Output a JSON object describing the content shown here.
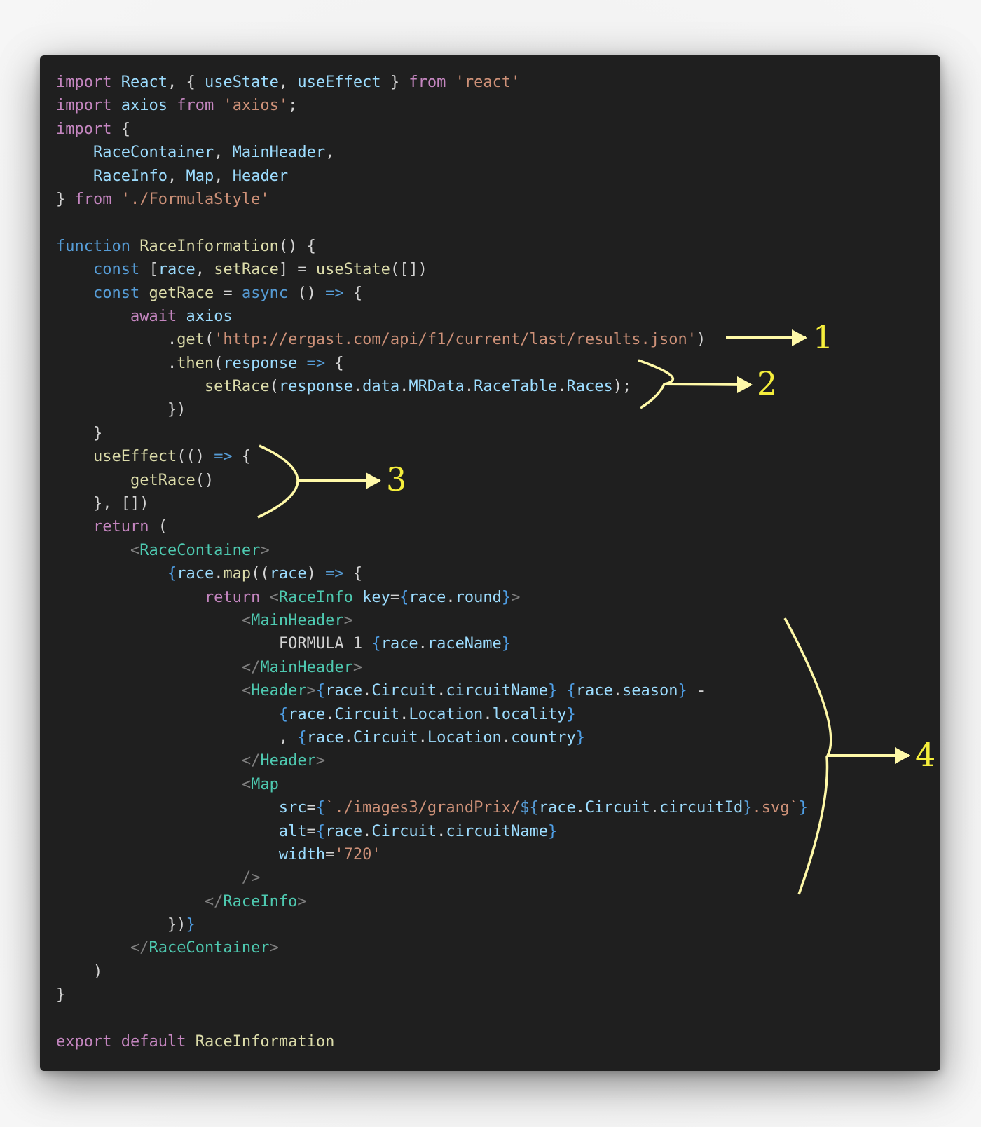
{
  "code_lines": [
    [
      [
        "kw",
        "import"
      ],
      [
        "plain",
        " "
      ],
      [
        "var",
        "React"
      ],
      [
        "plain",
        ", { "
      ],
      [
        "var",
        "useState"
      ],
      [
        "plain",
        ", "
      ],
      [
        "var",
        "useEffect"
      ],
      [
        "plain",
        " } "
      ],
      [
        "kw",
        "from"
      ],
      [
        "plain",
        " "
      ],
      [
        "str",
        "'react'"
      ]
    ],
    [
      [
        "kw",
        "import"
      ],
      [
        "plain",
        " "
      ],
      [
        "var",
        "axios"
      ],
      [
        "plain",
        " "
      ],
      [
        "kw",
        "from"
      ],
      [
        "plain",
        " "
      ],
      [
        "str",
        "'axios'"
      ],
      [
        "plain",
        ";"
      ]
    ],
    [
      [
        "kw",
        "import"
      ],
      [
        "plain",
        " {"
      ]
    ],
    [
      [
        "plain",
        "    "
      ],
      [
        "var",
        "RaceContainer"
      ],
      [
        "plain",
        ", "
      ],
      [
        "var",
        "MainHeader"
      ],
      [
        "plain",
        ","
      ]
    ],
    [
      [
        "plain",
        "    "
      ],
      [
        "var",
        "RaceInfo"
      ],
      [
        "plain",
        ", "
      ],
      [
        "var",
        "Map"
      ],
      [
        "plain",
        ", "
      ],
      [
        "var",
        "Header"
      ]
    ],
    [
      [
        "plain",
        "} "
      ],
      [
        "kw",
        "from"
      ],
      [
        "plain",
        " "
      ],
      [
        "str",
        "'./FormulaStyle'"
      ]
    ],
    [],
    [
      [
        "dec",
        "function"
      ],
      [
        "plain",
        " "
      ],
      [
        "fn",
        "RaceInformation"
      ],
      [
        "plain",
        "() {"
      ]
    ],
    [
      [
        "plain",
        "    "
      ],
      [
        "dec",
        "const"
      ],
      [
        "plain",
        " ["
      ],
      [
        "var",
        "race"
      ],
      [
        "plain",
        ", "
      ],
      [
        "fn",
        "setRace"
      ],
      [
        "plain",
        "] = "
      ],
      [
        "fn",
        "useState"
      ],
      [
        "plain",
        "([])"
      ]
    ],
    [
      [
        "plain",
        "    "
      ],
      [
        "dec",
        "const"
      ],
      [
        "plain",
        " "
      ],
      [
        "fn",
        "getRace"
      ],
      [
        "plain",
        " = "
      ],
      [
        "dec",
        "async"
      ],
      [
        "plain",
        " () "
      ],
      [
        "dec",
        "=>"
      ],
      [
        "plain",
        " {"
      ]
    ],
    [
      [
        "plain",
        "        "
      ],
      [
        "kw",
        "await"
      ],
      [
        "plain",
        " "
      ],
      [
        "var",
        "axios"
      ]
    ],
    [
      [
        "plain",
        "            ."
      ],
      [
        "fn",
        "get"
      ],
      [
        "plain",
        "("
      ],
      [
        "str",
        "'http://ergast.com/api/f1/current/last/results.json'"
      ],
      [
        "plain",
        ")"
      ]
    ],
    [
      [
        "plain",
        "            ."
      ],
      [
        "fn",
        "then"
      ],
      [
        "plain",
        "("
      ],
      [
        "var",
        "response"
      ],
      [
        "plain",
        " "
      ],
      [
        "dec",
        "=>"
      ],
      [
        "plain",
        " {"
      ]
    ],
    [
      [
        "plain",
        "                "
      ],
      [
        "fn",
        "setRace"
      ],
      [
        "plain",
        "("
      ],
      [
        "var",
        "response"
      ],
      [
        "plain",
        "."
      ],
      [
        "var",
        "data"
      ],
      [
        "plain",
        "."
      ],
      [
        "var",
        "MRData"
      ],
      [
        "plain",
        "."
      ],
      [
        "var",
        "RaceTable"
      ],
      [
        "plain",
        "."
      ],
      [
        "var",
        "Races"
      ],
      [
        "plain",
        ");"
      ]
    ],
    [
      [
        "plain",
        "            })"
      ]
    ],
    [
      [
        "plain",
        "    }"
      ]
    ],
    [
      [
        "plain",
        "    "
      ],
      [
        "fn",
        "useEffect"
      ],
      [
        "plain",
        "(() "
      ],
      [
        "dec",
        "=>"
      ],
      [
        "plain",
        " {"
      ]
    ],
    [
      [
        "plain",
        "        "
      ],
      [
        "fn",
        "getRace"
      ],
      [
        "plain",
        "()"
      ]
    ],
    [
      [
        "plain",
        "    }, [])"
      ]
    ],
    [
      [
        "plain",
        "    "
      ],
      [
        "kw",
        "return"
      ],
      [
        "plain",
        " ("
      ]
    ],
    [
      [
        "plain",
        "        "
      ],
      [
        "ang",
        "<"
      ],
      [
        "tag",
        "RaceContainer"
      ],
      [
        "ang",
        ">"
      ]
    ],
    [
      [
        "plain",
        "            "
      ],
      [
        "br",
        "{"
      ],
      [
        "var",
        "race"
      ],
      [
        "plain",
        "."
      ],
      [
        "fn",
        "map"
      ],
      [
        "plain",
        "(("
      ],
      [
        "var",
        "race"
      ],
      [
        "plain",
        ") "
      ],
      [
        "dec",
        "=>"
      ],
      [
        "plain",
        " {"
      ]
    ],
    [
      [
        "plain",
        "                "
      ],
      [
        "kw",
        "return"
      ],
      [
        "plain",
        " "
      ],
      [
        "ang",
        "<"
      ],
      [
        "tag",
        "RaceInfo"
      ],
      [
        "plain",
        " "
      ],
      [
        "var",
        "key"
      ],
      [
        "plain",
        "="
      ],
      [
        "br",
        "{"
      ],
      [
        "var",
        "race"
      ],
      [
        "plain",
        "."
      ],
      [
        "var",
        "round"
      ],
      [
        "br",
        "}"
      ],
      [
        "ang",
        ">"
      ]
    ],
    [
      [
        "plain",
        "                    "
      ],
      [
        "ang",
        "<"
      ],
      [
        "tag",
        "MainHeader"
      ],
      [
        "ang",
        ">"
      ]
    ],
    [
      [
        "plain",
        "                        "
      ],
      [
        "txt",
        "FORMULA 1 "
      ],
      [
        "br",
        "{"
      ],
      [
        "var",
        "race"
      ],
      [
        "plain",
        "."
      ],
      [
        "var",
        "raceName"
      ],
      [
        "br",
        "}"
      ]
    ],
    [
      [
        "plain",
        "                    "
      ],
      [
        "ang",
        "</"
      ],
      [
        "tag",
        "MainHeader"
      ],
      [
        "ang",
        ">"
      ]
    ],
    [
      [
        "plain",
        "                    "
      ],
      [
        "ang",
        "<"
      ],
      [
        "tag",
        "Header"
      ],
      [
        "ang",
        ">"
      ],
      [
        "br",
        "{"
      ],
      [
        "var",
        "race"
      ],
      [
        "plain",
        "."
      ],
      [
        "var",
        "Circuit"
      ],
      [
        "plain",
        "."
      ],
      [
        "var",
        "circuitName"
      ],
      [
        "br",
        "}"
      ],
      [
        "plain",
        " "
      ],
      [
        "br",
        "{"
      ],
      [
        "var",
        "race"
      ],
      [
        "plain",
        "."
      ],
      [
        "var",
        "season"
      ],
      [
        "br",
        "}"
      ],
      [
        "txt",
        " -"
      ]
    ],
    [
      [
        "plain",
        "                        "
      ],
      [
        "br",
        "{"
      ],
      [
        "var",
        "race"
      ],
      [
        "plain",
        "."
      ],
      [
        "var",
        "Circuit"
      ],
      [
        "plain",
        "."
      ],
      [
        "var",
        "Location"
      ],
      [
        "plain",
        "."
      ],
      [
        "var",
        "locality"
      ],
      [
        "br",
        "}"
      ]
    ],
    [
      [
        "plain",
        "                        "
      ],
      [
        "txt",
        ", "
      ],
      [
        "br",
        "{"
      ],
      [
        "var",
        "race"
      ],
      [
        "plain",
        "."
      ],
      [
        "var",
        "Circuit"
      ],
      [
        "plain",
        "."
      ],
      [
        "var",
        "Location"
      ],
      [
        "plain",
        "."
      ],
      [
        "var",
        "country"
      ],
      [
        "br",
        "}"
      ]
    ],
    [
      [
        "plain",
        "                    "
      ],
      [
        "ang",
        "</"
      ],
      [
        "tag",
        "Header"
      ],
      [
        "ang",
        ">"
      ]
    ],
    [
      [
        "plain",
        "                    "
      ],
      [
        "ang",
        "<"
      ],
      [
        "tag",
        "Map"
      ]
    ],
    [
      [
        "plain",
        "                        "
      ],
      [
        "var",
        "src"
      ],
      [
        "plain",
        "="
      ],
      [
        "br",
        "{"
      ],
      [
        "str",
        "`./images3/grandPrix/"
      ],
      [
        "dec",
        "${"
      ],
      [
        "var",
        "race"
      ],
      [
        "plain",
        "."
      ],
      [
        "var",
        "Circuit"
      ],
      [
        "plain",
        "."
      ],
      [
        "var",
        "circuitId"
      ],
      [
        "dec",
        "}"
      ],
      [
        "str",
        ".svg`"
      ],
      [
        "br",
        "}"
      ]
    ],
    [
      [
        "plain",
        "                        "
      ],
      [
        "var",
        "alt"
      ],
      [
        "plain",
        "="
      ],
      [
        "br",
        "{"
      ],
      [
        "var",
        "race"
      ],
      [
        "plain",
        "."
      ],
      [
        "var",
        "Circuit"
      ],
      [
        "plain",
        "."
      ],
      [
        "var",
        "circuitName"
      ],
      [
        "br",
        "}"
      ]
    ],
    [
      [
        "plain",
        "                        "
      ],
      [
        "var",
        "width"
      ],
      [
        "plain",
        "="
      ],
      [
        "str",
        "'720'"
      ]
    ],
    [
      [
        "plain",
        "                    "
      ],
      [
        "ang",
        "/>"
      ]
    ],
    [
      [
        "plain",
        "                "
      ],
      [
        "ang",
        "</"
      ],
      [
        "tag",
        "RaceInfo"
      ],
      [
        "ang",
        ">"
      ]
    ],
    [
      [
        "plain",
        "            })"
      ],
      [
        "br",
        "}"
      ]
    ],
    [
      [
        "plain",
        "        "
      ],
      [
        "ang",
        "</"
      ],
      [
        "tag",
        "RaceContainer"
      ],
      [
        "ang",
        ">"
      ]
    ],
    [
      [
        "plain",
        "    )"
      ]
    ],
    [
      [
        "plain",
        "}"
      ]
    ],
    [],
    [
      [
        "kw",
        "export"
      ],
      [
        "plain",
        " "
      ],
      [
        "kw",
        "default"
      ],
      [
        "plain",
        " "
      ],
      [
        "fn",
        "RaceInformation"
      ]
    ]
  ],
  "annotations": [
    {
      "label": "1"
    },
    {
      "label": "2"
    },
    {
      "label": "3"
    },
    {
      "label": "4"
    }
  ],
  "colors": {
    "panel_bg": "#1f1f1f",
    "annotation": "#fff9a8",
    "annotation_number": "#f5ee3c"
  }
}
